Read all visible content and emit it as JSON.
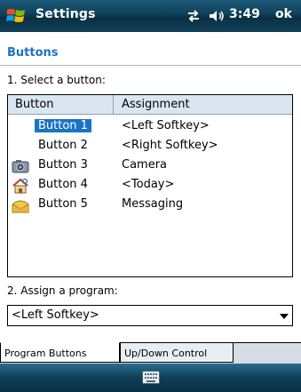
{
  "titlebar": {
    "app_title": "Settings",
    "clock": "3:49",
    "ok_label": "ok"
  },
  "page": {
    "title": "Buttons"
  },
  "section1_label": "1. Select a button:",
  "list": {
    "col_button": "Button",
    "col_assignment": "Assignment",
    "rows": [
      {
        "name": "Button 1",
        "assignment": "<Left Softkey>",
        "icon": "",
        "selected": true
      },
      {
        "name": "Button 2",
        "assignment": "<Right Softkey>",
        "icon": "",
        "selected": false
      },
      {
        "name": "Button 3",
        "assignment": "Camera",
        "icon": "camera-icon",
        "selected": false
      },
      {
        "name": "Button 4",
        "assignment": "<Today>",
        "icon": "home-icon",
        "selected": false
      },
      {
        "name": "Button 5",
        "assignment": "Messaging",
        "icon": "envelope-icon",
        "selected": false
      }
    ]
  },
  "section2_label": "2. Assign a program:",
  "combo_value": "<Left Softkey>",
  "tabs": [
    "Program Buttons",
    "Up/Down Control"
  ],
  "colors": {
    "accent": "#1a73c5",
    "titlebar": "#0f3f58"
  }
}
